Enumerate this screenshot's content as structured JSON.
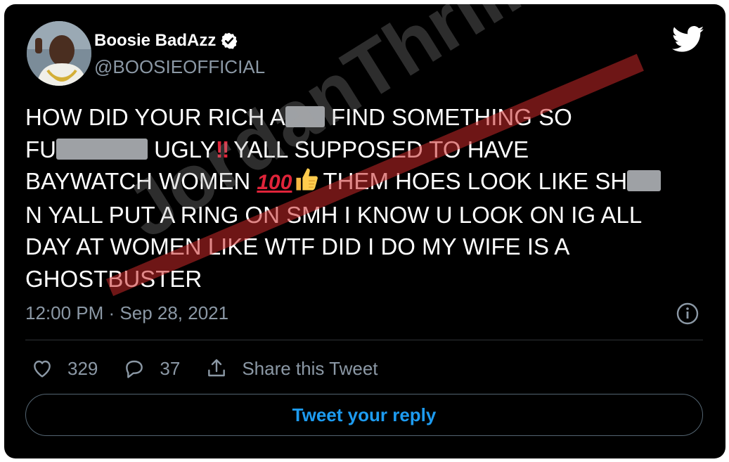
{
  "author": {
    "name": "Boosie BadAzz",
    "handle": "@BOOSIEOFFICIAL",
    "verified": true,
    "avatar_icon": "profile-photo"
  },
  "tweet": {
    "lines": [
      {
        "a": "HOW DID YOUR RICH A",
        "b": "FIND SOMETHING SO"
      },
      {
        "a": "FU",
        "b": "UGLY",
        "c": "YALL SUPPOSED TO HAVE"
      },
      {
        "a": "BAYWATCH WOMEN",
        "b": "THEM HOES LOOK LIKE SH"
      },
      {
        "a": "N YALL PUT A RING ON SMH I KNOW U LOOK ON IG ALL"
      },
      {
        "a": "DAY AT WOMEN LIKE WTF DID I DO MY WIFE IS A"
      },
      {
        "a": "GHOSTBUSTER"
      }
    ],
    "emoji": {
      "double_exclamation": "‼",
      "hundred": "100"
    },
    "timestamp": "12:00 PM · Sep 28, 2021"
  },
  "actions": {
    "likes": "329",
    "replies": "37",
    "share_label": "Share this Tweet"
  },
  "reply_button": "Tweet your reply",
  "watermark": "JordanThrilla.",
  "colors": {
    "background": "#000000",
    "accent": "#1d9bf0",
    "muted": "#8b98a5",
    "redaction": "#9ea1a5"
  }
}
